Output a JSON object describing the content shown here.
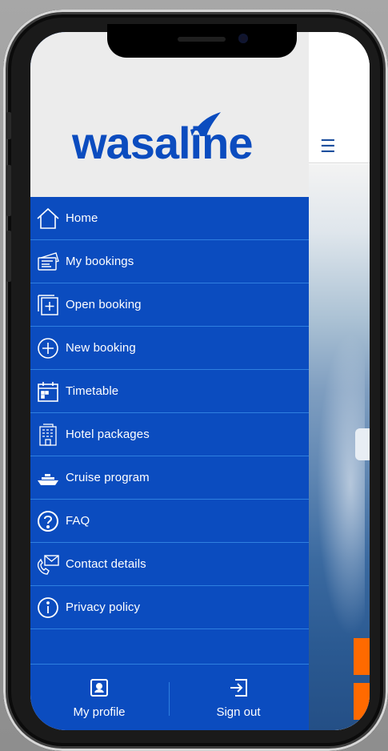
{
  "brand": {
    "logo_text": "wasaline",
    "logo_color": "#0b4cbf"
  },
  "drawer": {
    "background": "#0b4cbf",
    "items": [
      {
        "label": "Home",
        "icon": "house-icon"
      },
      {
        "label": "My bookings",
        "icon": "tickets-icon"
      },
      {
        "label": "Open booking",
        "icon": "open-booking-icon"
      },
      {
        "label": "New booking",
        "icon": "plus-circle-icon"
      },
      {
        "label": "Timetable",
        "icon": "calendar-icon"
      },
      {
        "label": "Hotel packages",
        "icon": "hotel-icon"
      },
      {
        "label": "Cruise program",
        "icon": "ship-icon"
      },
      {
        "label": "FAQ",
        "icon": "question-icon"
      },
      {
        "label": "Contact details",
        "icon": "contact-icon"
      },
      {
        "label": "Privacy policy",
        "icon": "info-icon"
      }
    ]
  },
  "footer": {
    "profile_label": "My profile",
    "profile_icon": "profile-icon",
    "signout_label": "Sign out",
    "signout_icon": "sign-out-icon"
  },
  "app": {
    "menu_icon": "hamburger-menu-icon",
    "accent": "#ff6a00"
  }
}
